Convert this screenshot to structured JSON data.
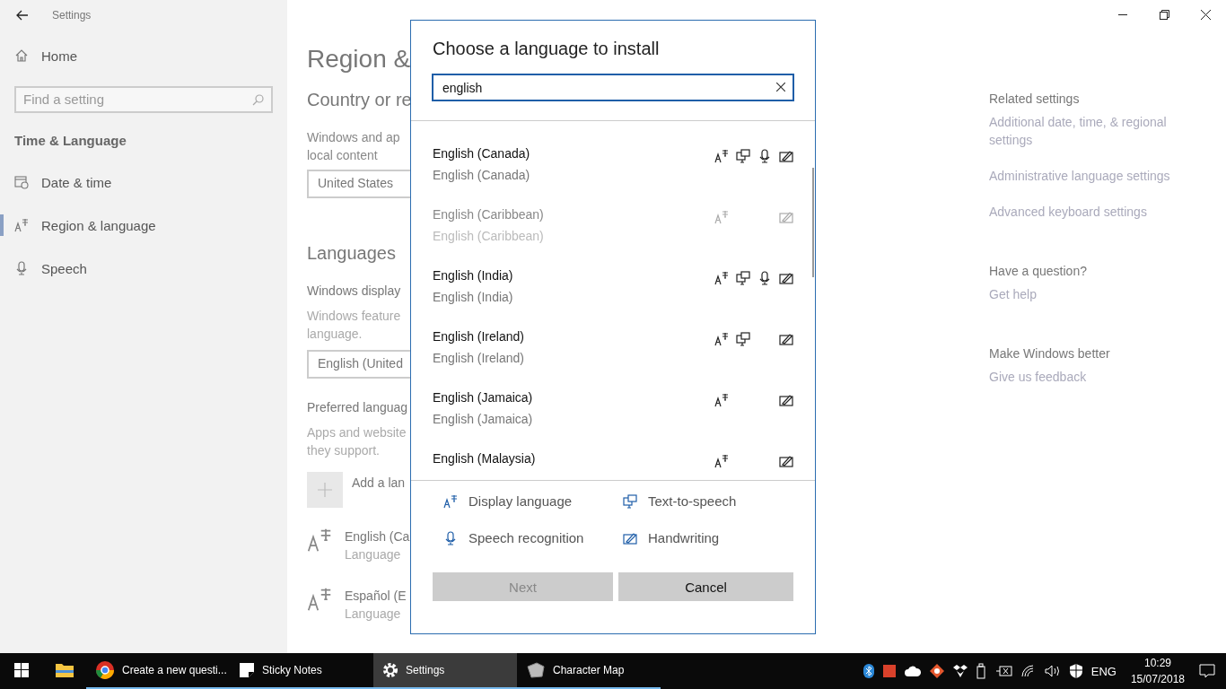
{
  "window": {
    "title": "Settings"
  },
  "sidebar": {
    "home": "Home",
    "search": {
      "placeholder": "Find a setting"
    },
    "section": "Time & Language",
    "items": [
      {
        "label": "Date & time",
        "selected": false
      },
      {
        "label": "Region & language",
        "selected": true
      },
      {
        "label": "Speech",
        "selected": false
      }
    ]
  },
  "main": {
    "title": "Region &",
    "country_heading": "Country or re",
    "country_text": [
      "Windows and ap",
      "local content"
    ],
    "country_value": "United States",
    "languages_heading": "Languages",
    "display_label": "Windows display",
    "display_text": [
      "Windows feature",
      "language."
    ],
    "display_value": "English (United",
    "preferred_label": "Preferred languag",
    "preferred_text": [
      "Apps and website",
      "they support."
    ],
    "add_label": "Add a lan",
    "languages": [
      {
        "name": "English (Ca",
        "status": "Language"
      },
      {
        "name": "Español (E",
        "status": "Language"
      }
    ]
  },
  "related": {
    "heading": "Related settings",
    "links": [
      "Additional date, time, & regional settings",
      "Administrative language settings",
      "Advanced keyboard settings"
    ],
    "question_heading": "Have a question?",
    "question_link": "Get help",
    "better_heading": "Make Windows better",
    "better_link": "Give us feedback"
  },
  "dialog": {
    "title": "Choose a language to install",
    "search": {
      "value": "english"
    },
    "languages": [
      {
        "name": "English (Canada)",
        "native": "English (Canada)",
        "disabled": false,
        "display": true,
        "tts": true,
        "speech": true,
        "handwriting": true
      },
      {
        "name": "English (Caribbean)",
        "native": "English (Caribbean)",
        "disabled": true,
        "display": true,
        "tts": false,
        "speech": false,
        "handwriting": true
      },
      {
        "name": "English (India)",
        "native": "English (India)",
        "disabled": false,
        "display": true,
        "tts": true,
        "speech": true,
        "handwriting": true
      },
      {
        "name": "English (Ireland)",
        "native": "English (Ireland)",
        "disabled": false,
        "display": true,
        "tts": true,
        "speech": false,
        "handwriting": true
      },
      {
        "name": "English (Jamaica)",
        "native": "English (Jamaica)",
        "disabled": false,
        "display": true,
        "tts": false,
        "speech": false,
        "handwriting": true
      },
      {
        "name": "English (Malaysia)",
        "disabled": false,
        "display": true,
        "tts": false,
        "speech": false,
        "handwriting": true
      }
    ],
    "legend": [
      {
        "kind": "display",
        "label": "Display language"
      },
      {
        "kind": "tts",
        "label": "Text-to-speech"
      },
      {
        "kind": "speech",
        "label": "Speech recognition"
      },
      {
        "kind": "handwriting",
        "label": "Handwriting"
      }
    ],
    "buttons": [
      {
        "label": "Next",
        "disabled": true
      },
      {
        "label": "Cancel",
        "disabled": false
      }
    ]
  },
  "taskbar": {
    "apps": [
      {
        "kind": "folder",
        "active": false
      },
      {
        "kind": "chrome",
        "label": "Create a new questi...",
        "active": false
      },
      {
        "kind": "notes",
        "label": "Sticky Notes",
        "active": false
      },
      {
        "kind": "gear",
        "label": "Settings",
        "active": true
      },
      {
        "kind": "charmap",
        "label": "Character Map",
        "active": false
      }
    ],
    "language": "ENG",
    "time": "10:29",
    "date": "15/07/2018"
  }
}
